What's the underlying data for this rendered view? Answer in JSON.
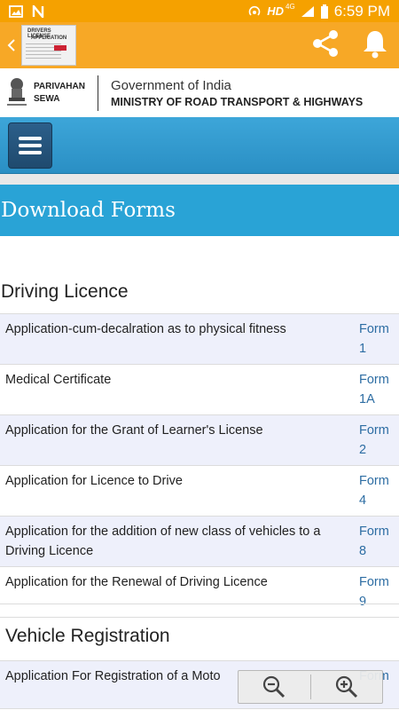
{
  "status": {
    "time": "6:59 PM",
    "network": "HD",
    "signal_label": "4G"
  },
  "app_bar": {
    "thumb_line1": "DRIVERS LICENSE",
    "thumb_line2": "APPLICATION"
  },
  "header": {
    "parivahan_line1": "PARIVAHAN",
    "parivahan_line2": "SEWA",
    "gov": "Government of India",
    "ministry": "MINISTRY OF ROAD TRANSPORT & HIGHWAYS"
  },
  "page_title": "Download Forms",
  "driving_licence": {
    "title": "Driving Licence",
    "rows": [
      {
        "desc": "Application-cum-decalration as to physical fitness",
        "form": "Form\n1"
      },
      {
        "desc": "Medical Certificate",
        "form": "Form\n1A"
      },
      {
        "desc": "Application for the Grant of Learner's License",
        "form": "Form\n2"
      },
      {
        "desc": "Application for Licence to Drive",
        "form": "Form\n4"
      },
      {
        "desc": "Application for the addition of new class of vehicles to a Driving Licence",
        "form": "Form\n8"
      },
      {
        "desc": "Application for the Renewal of Driving Licence",
        "form": "Form\n9"
      }
    ]
  },
  "vehicle_registration": {
    "title": "Vehicle Registration",
    "rows": [
      {
        "desc": "Application For Registration of a Moto",
        "form": "Form"
      }
    ]
  },
  "colors": {
    "app_bar": "#f7a826",
    "nav_bar": "#3da6d9",
    "title_bar": "#29a3d6",
    "link": "#2d6da3",
    "alt_row": "#eef0fb"
  },
  "icons": {
    "back": "chevron-left-icon",
    "share": "share-icon",
    "bell": "bell-icon",
    "menu": "hamburger-icon",
    "zoom_out": "zoom-out-icon",
    "zoom_in": "zoom-in-icon"
  }
}
